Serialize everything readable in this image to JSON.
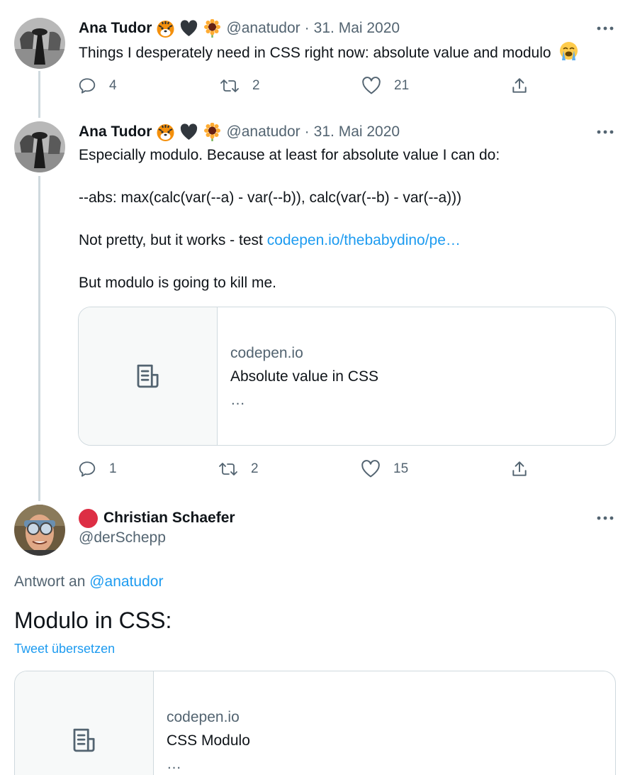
{
  "tweets": [
    {
      "author": "Ana Tudor",
      "handle": "@anatudor",
      "separator": "·",
      "date": "31. Mai 2020",
      "text": "Things I desperately need in CSS right now: absolute value and modulo",
      "emojis": [
        "tiger-face",
        "black-heart",
        "sunflower"
      ],
      "text_emoji": "loudly-crying-face",
      "actions": {
        "replies": "4",
        "retweets": "2",
        "likes": "21"
      }
    },
    {
      "author": "Ana Tudor",
      "handle": "@anatudor",
      "separator": "·",
      "date": "31. Mai 2020",
      "lines": [
        "Especially modulo. Because at least for absolute value I can do:",
        "--abs: max(calc(var(--a) - var(--b)), calc(var(--b) - var(--a)))",
        "Not pretty, but it works - test ",
        "But modulo is going to kill me."
      ],
      "link": "codepen.io/thebabydino/pe…",
      "card": {
        "domain": "codepen.io",
        "title": "Absolute value in CSS",
        "ellipsis": "…"
      },
      "actions": {
        "replies": "1",
        "retweets": "2",
        "likes": "15"
      }
    }
  ],
  "reply": {
    "author": "Christian Schaefer",
    "handle": "@derSchepp",
    "reply_prefix": "Antwort an ",
    "reply_handle": "@anatudor",
    "text": "Modulo in CSS:",
    "translate": "Tweet übersetzen",
    "card": {
      "domain": "codepen.io",
      "title": "CSS Modulo",
      "ellipsis": "…"
    }
  },
  "colors": {
    "link": "#1d9bf0",
    "secondary_text": "#536471",
    "thread_line": "#cfd9de",
    "status_dot": "#dd2e44"
  }
}
